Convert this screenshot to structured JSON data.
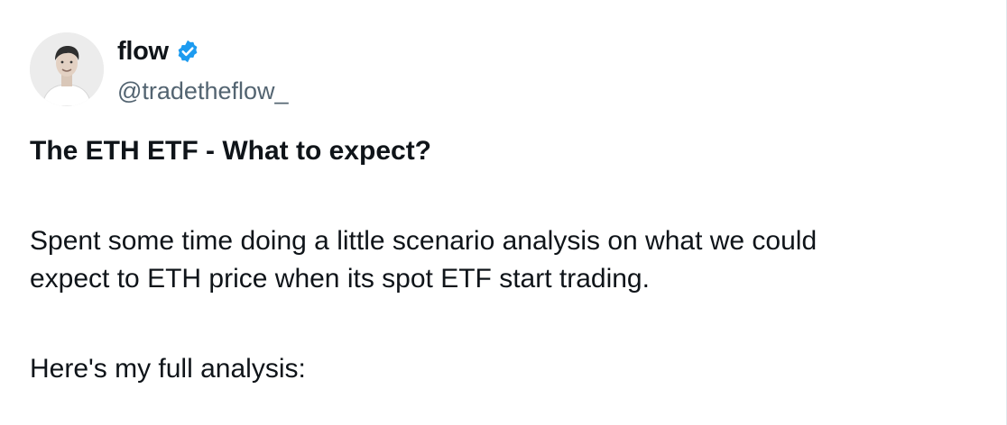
{
  "author": {
    "display_name": "flow",
    "handle": "@tradetheflow_",
    "verified_icon": "verified-badge-icon",
    "avatar_icon": "profile-photo"
  },
  "tweet": {
    "title": "The ETH ETF - What to expect?",
    "line1": "Spent some time doing a little scenario analysis on what we could",
    "line2": "expect to ETH price when its spot ETF start trading.",
    "line3": "Here's my full analysis:"
  },
  "colors": {
    "text": "#0f1419",
    "secondary": "#536471",
    "verified": "#1d9bf0"
  }
}
